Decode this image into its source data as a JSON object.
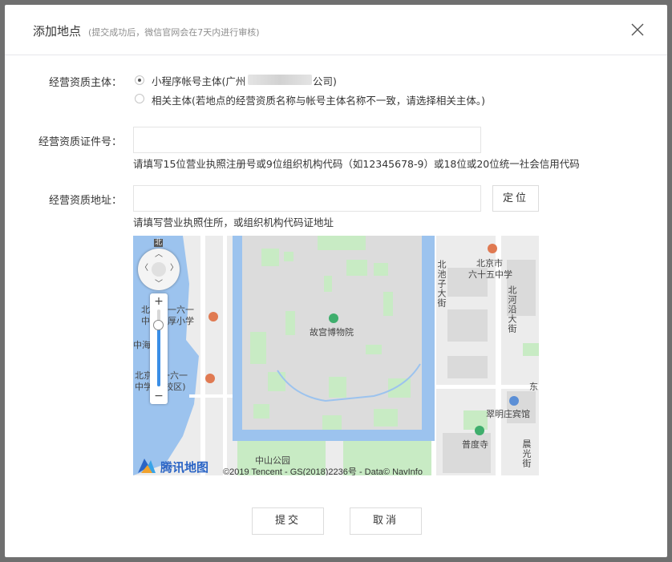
{
  "dialog": {
    "title": "添加地点",
    "subtitle": "(提交成功后，微信官网会在7天内进行审核)"
  },
  "form": {
    "subject_label": "经营资质主体：",
    "option1_prefix": "小程序帐号主体(广州",
    "option1_suffix": "公司)",
    "option2": "相关主体(若地点的经营资质名称与帐号主体名称不一致，请选择相关主体。)",
    "license_label": "经营资质证件号：",
    "license_value": "",
    "license_hint": "请填写15位营业执照注册号或9位组织机构代码（如12345678-9）或18位或20位统一社会信用代码",
    "address_label": "经营资质地址：",
    "address_value": "",
    "locate_button": "定位",
    "address_hint": "请填写营业执照住所，或组织机构代码证地址"
  },
  "map": {
    "north": "北",
    "zoom_in": "+",
    "zoom_out": "−",
    "zoom_level": 0.8,
    "labels": {
      "school1_a": "北京第一六一",
      "school1_b": "中学附厚小学",
      "zhonghai": "中海",
      "school2_a": "北京第一六一",
      "school2_b": "中学(北校区)",
      "gugong": "故宫博物院",
      "beichizi": "北池子大街",
      "school3_a": "北京市",
      "school3_b": "六十五中学",
      "beiheyan": "北河沿大街",
      "dong": "东",
      "cuiming": "翠明庄宾馆",
      "pudu": "普度寺",
      "chenguang": "晨光街",
      "zhongshan": "中山公园"
    },
    "logo_text": "腾讯地图",
    "copyright": "©2019 Tencent - GS(2018)2236号 - Data© NavInfo"
  },
  "footer": {
    "submit": "提交",
    "cancel": "取消"
  }
}
